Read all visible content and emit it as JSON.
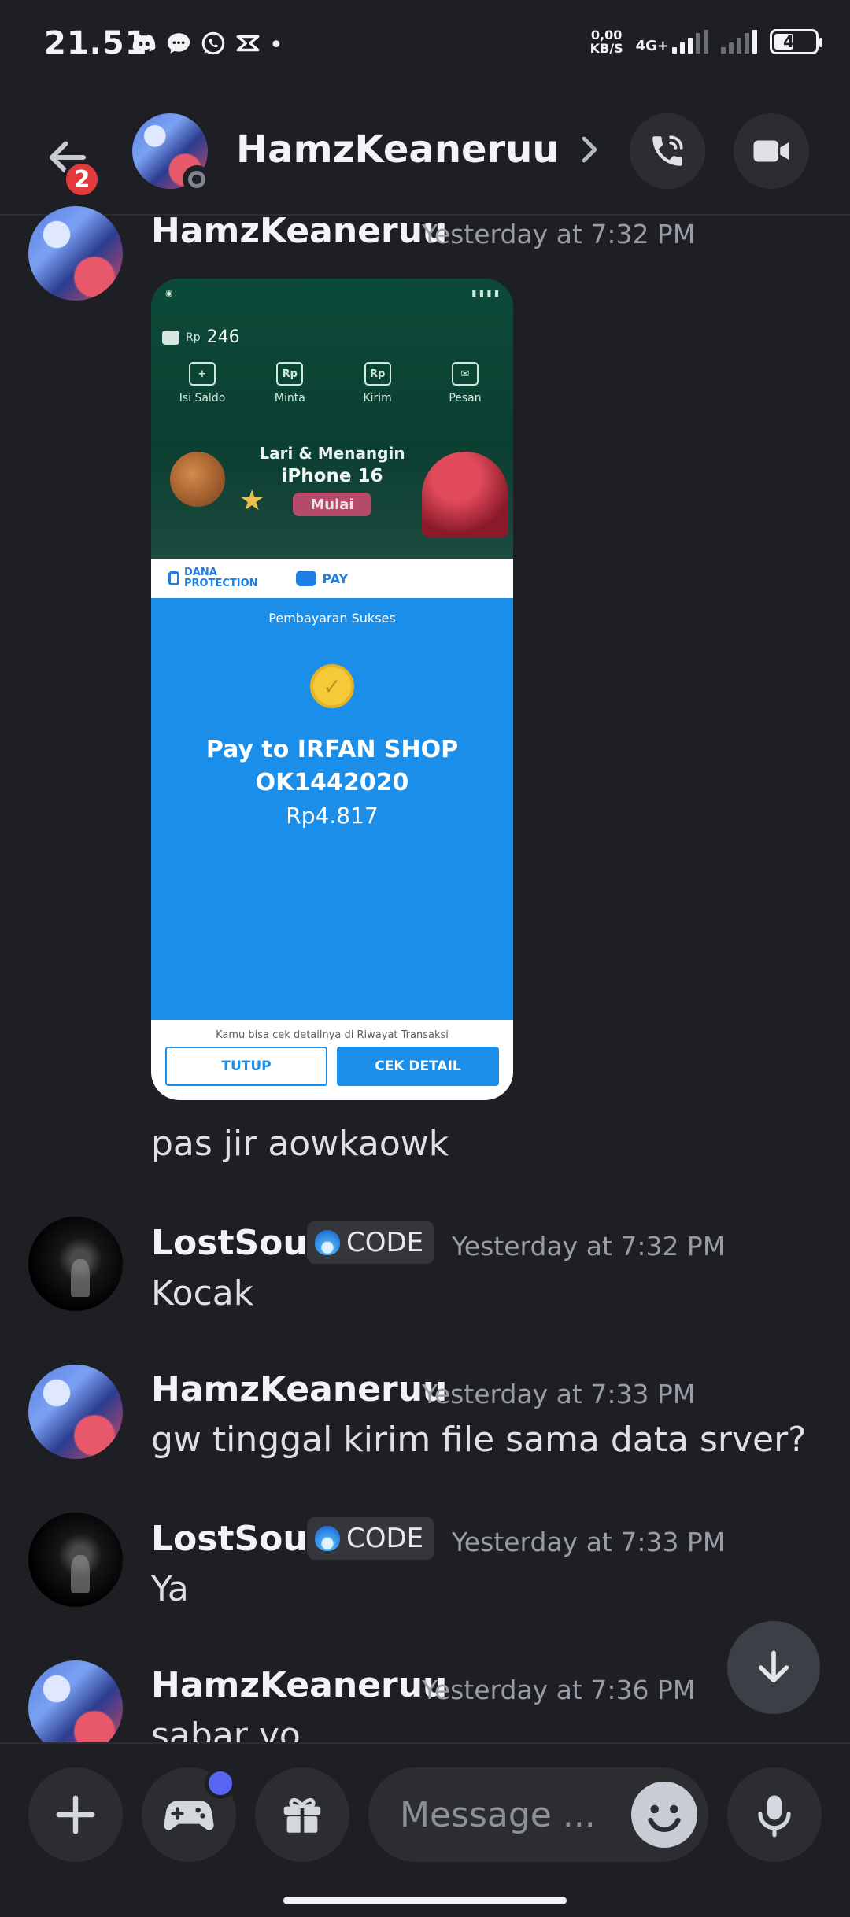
{
  "status_bar": {
    "time": "21.51",
    "net_speed_value": "0,00",
    "net_speed_unit": "KB/S",
    "network_type": "4G+",
    "battery_level": "40"
  },
  "header": {
    "unread_count": "2",
    "contact_name": "HamzKeaneruu"
  },
  "attachment": {
    "balance_currency": "Rp",
    "balance": "246",
    "actions": [
      "Isi Saldo",
      "Minta",
      "Kirim",
      "Pesan"
    ],
    "action_icon_text": "Rp",
    "promo_title": "Lari & Menangin",
    "promo_subtitle": "iPhone 16",
    "promo_button": "Mulai",
    "protection_line1": "DANA",
    "protection_line2": "PROTECTION",
    "pay_label": "PAY",
    "success_text": "Pembayaran Sukses",
    "pay_to_line1": "Pay to IRFAN SHOP",
    "pay_to_line2": "OK1442020",
    "amount": "Rp4.817",
    "footer_note": "Kamu bisa cek detailnya di Riwayat Transaksi",
    "close_button": "TUTUP",
    "detail_button": "CEK DETAIL"
  },
  "messages": [
    {
      "author": "HamzKeaneruu",
      "time": "Yesterday at 7:32 PM",
      "text": ""
    },
    {
      "author": "",
      "time": "",
      "text": "pas jir aowkaowk"
    },
    {
      "author": "LostSoul",
      "tag": "CODE",
      "time": "Yesterday at 7:32 PM",
      "text": "Kocak"
    },
    {
      "author": "HamzKeaneruu",
      "time": "Yesterday at 7:33 PM",
      "text": "gw tinggal kirim file sama data srver?"
    },
    {
      "author": "LostSoul",
      "tag": "CODE",
      "time": "Yesterday at 7:33 PM",
      "text": "Ya"
    },
    {
      "author": "HamzKeaneruu",
      "time": "Yesterday at 7:36 PM",
      "text": "sabar yo"
    }
  ],
  "composer": {
    "placeholder": "Message ..."
  },
  "colors": {
    "background": "#1e1f24",
    "surface": "#2b2d31",
    "accent": "#5865f2",
    "badge": "#e4393c",
    "dana_blue": "#1a8ee9"
  },
  "icons": [
    "back-arrow-icon",
    "phone-icon",
    "video-camera-icon",
    "chevron-right-icon",
    "plus-icon",
    "gamepad-icon",
    "gift-icon",
    "emoji-icon",
    "microphone-icon",
    "arrow-down-icon"
  ]
}
